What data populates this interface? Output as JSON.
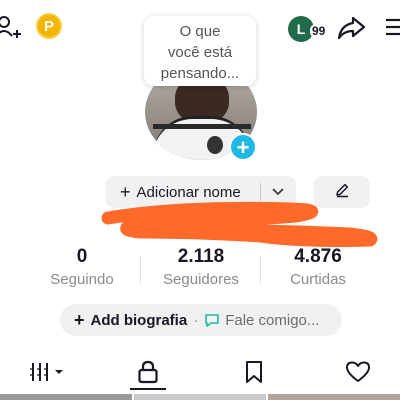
{
  "top_bar": {
    "add_friends_icon": "person-plus-icon",
    "coin_letter": "P",
    "profile_initial": "L",
    "profile_badge_count": "99",
    "share_icon": "share-arrow-icon",
    "menu_icon": "hamburger-menu-icon"
  },
  "bubble": {
    "line1": "O que",
    "line2": "você está",
    "line3": "pensando..."
  },
  "profile": {
    "add_photo_symbol": "+"
  },
  "name_row": {
    "add_name_symbol": "+",
    "add_name_label": "Adicionar nome",
    "chevron": "⌄",
    "edit_icon": "pencil-icon"
  },
  "stats": [
    {
      "value": "0",
      "label": "Seguindo"
    },
    {
      "value": "2.118",
      "label": "Seguidores"
    },
    {
      "value": "4.876",
      "label": "Curtidas"
    }
  ],
  "bio": {
    "add_symbol": "+",
    "add_label": "Add biografia",
    "separator": "·",
    "chat_label": "Fale comigo..."
  },
  "tabs": [
    {
      "icon": "videos-grid-icon",
      "selected": false
    },
    {
      "icon": "lock-icon",
      "selected": true
    },
    {
      "icon": "bookmark-icon",
      "selected": false
    },
    {
      "icon": "heart-icon",
      "selected": false
    }
  ],
  "colors": {
    "accent_blue": "#20b9e6",
    "coin": "#f5b400",
    "scribble": "#ff6a2a",
    "button_bg": "#f1f1f2",
    "secondary_text": "#8a8b91"
  }
}
